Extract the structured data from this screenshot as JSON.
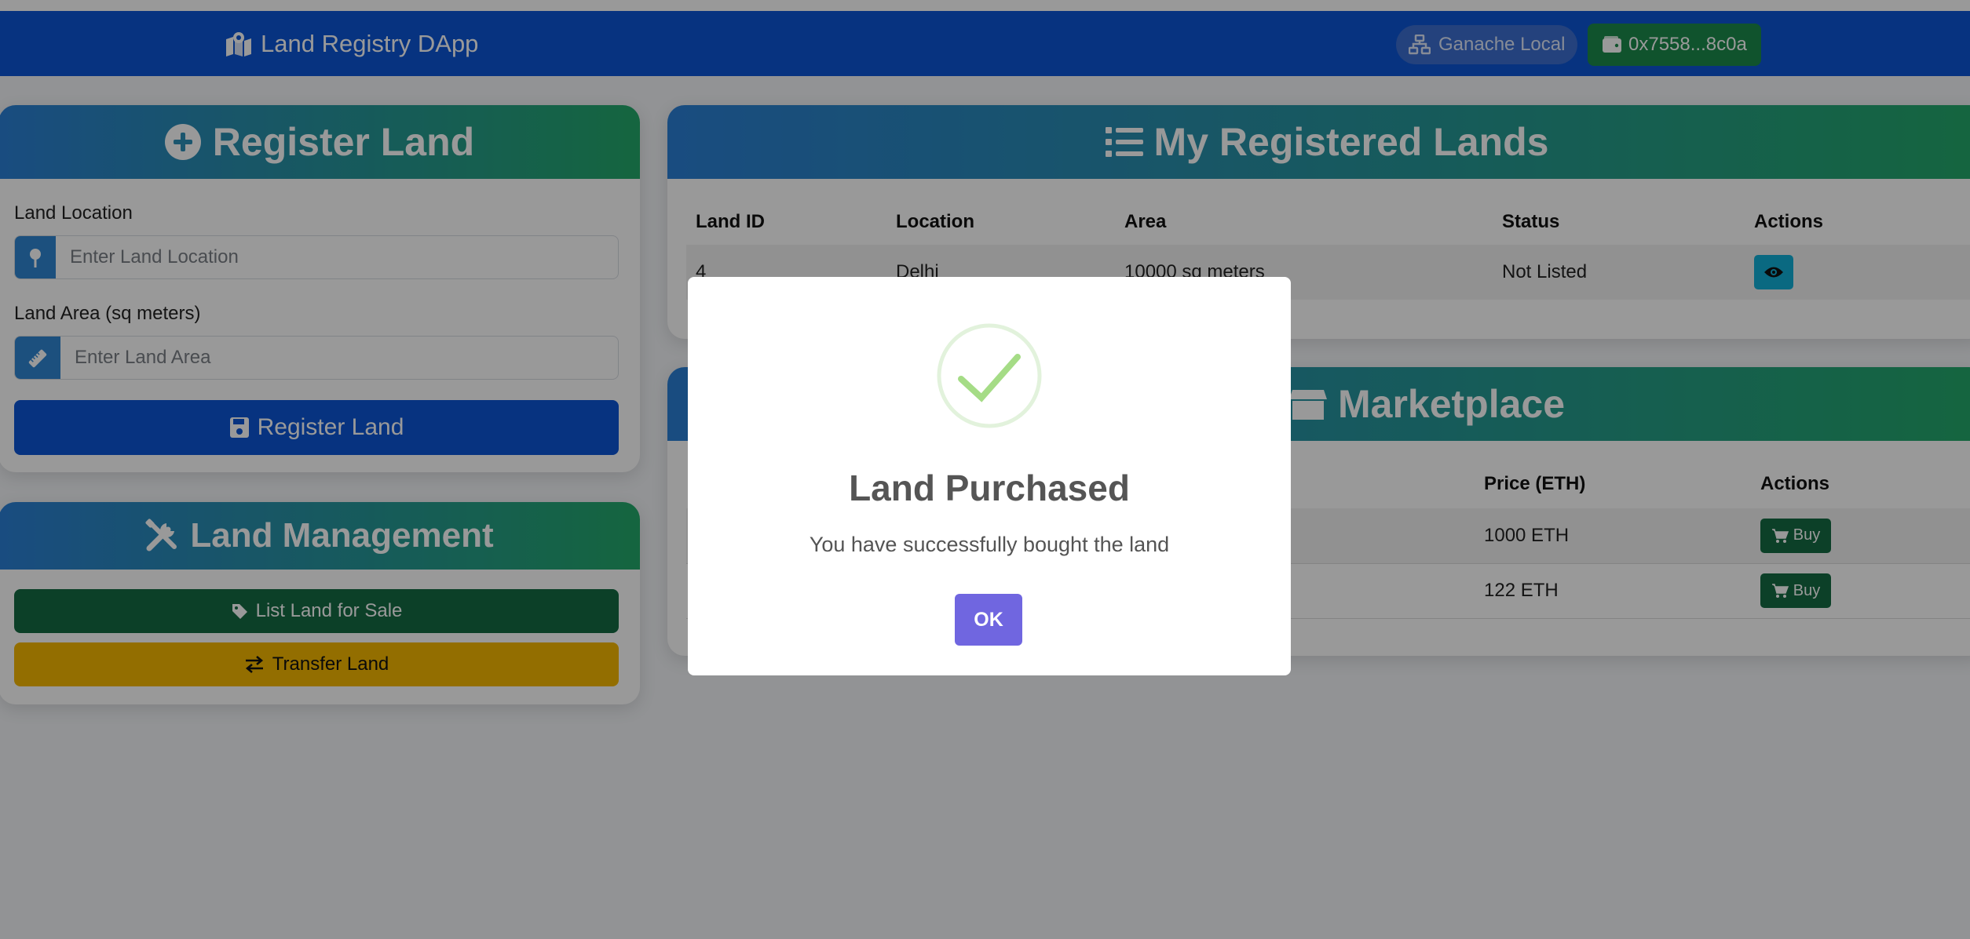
{
  "navbar": {
    "brand": "Land Registry DApp",
    "network": "Ganache Local",
    "wallet": "0x7558...8c0a"
  },
  "register_card": {
    "title": "Register Land",
    "location_label": "Land Location",
    "location_placeholder": "Enter Land Location",
    "area_label": "Land Area (sq meters)",
    "area_placeholder": "Enter Land Area",
    "submit_label": "Register Land"
  },
  "management_card": {
    "title": "Land Management",
    "list_label": "List Land for Sale",
    "transfer_label": "Transfer Land"
  },
  "my_lands": {
    "title": "My Registered Lands",
    "headers": [
      "Land ID",
      "Location",
      "Area",
      "Status",
      "Actions"
    ],
    "rows": [
      {
        "id": "4",
        "location": "Delhi",
        "area": "10000 sq meters",
        "status": "Not Listed"
      }
    ]
  },
  "marketplace": {
    "title": "Marketplace",
    "headers": {
      "price": "Price (ETH)",
      "actions": "Actions"
    },
    "rows": [
      {
        "price": "1000 ETH",
        "buy_label": "Buy"
      },
      {
        "price": "122 ETH",
        "buy_label": "Buy"
      }
    ]
  },
  "modal": {
    "title": "Land Purchased",
    "text": "You have successfully bought the land",
    "ok_label": "OK"
  },
  "colors": {
    "navbar": "#0d55d6",
    "header_gradient_start": "#2b7fd6",
    "header_gradient_end": "#23a96a",
    "primary": "#0d55d6",
    "success": "#1c8a4c",
    "warning": "#f5b800",
    "info": "#11b0d8",
    "modal_button": "#7066e0"
  }
}
